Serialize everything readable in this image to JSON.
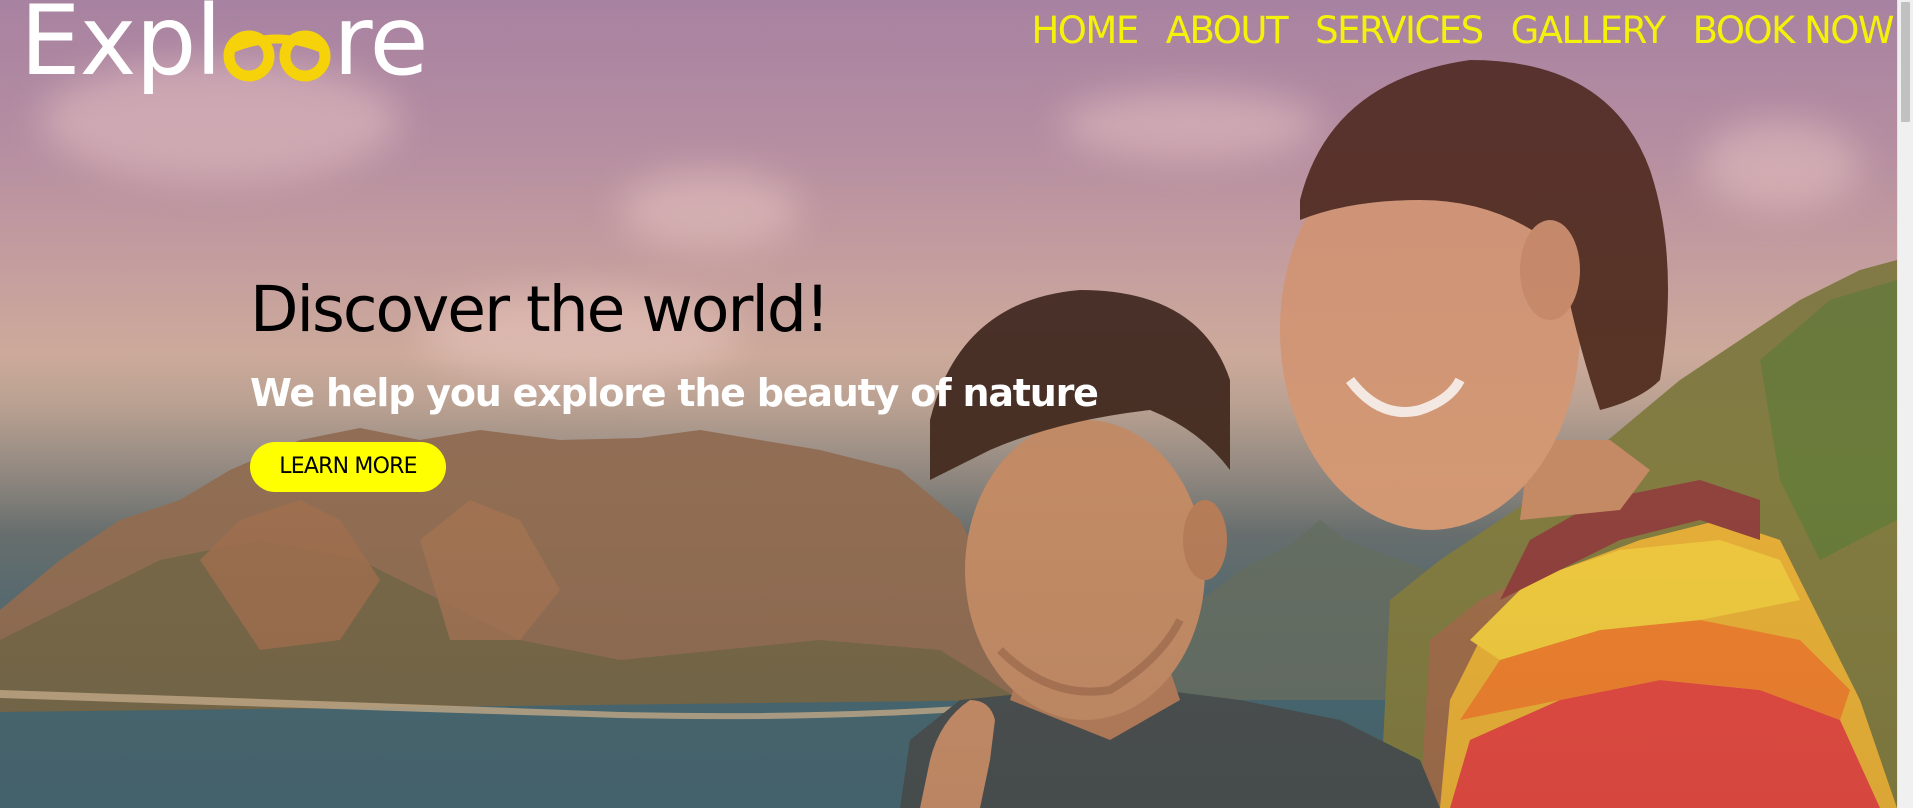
{
  "brand": {
    "logo_prefix": "Expl",
    "logo_suffix": "re",
    "logo_accent_color": "#f5d20a",
    "logo_text_color": "#ffffff"
  },
  "nav": {
    "items": [
      {
        "label": "HOME"
      },
      {
        "label": "ABOUT"
      },
      {
        "label": "SERVICES"
      },
      {
        "label": "GALLERY"
      },
      {
        "label": "BOOK NOW"
      }
    ],
    "link_color": "#f5f20a"
  },
  "hero": {
    "title": "Discover the world!",
    "subtitle": "We help you explore the beauty of nature",
    "cta_label": "LEARN MORE",
    "cta_color": "#ffff00",
    "background_image": "photo-couple-overlooking-coastal-mountains"
  }
}
